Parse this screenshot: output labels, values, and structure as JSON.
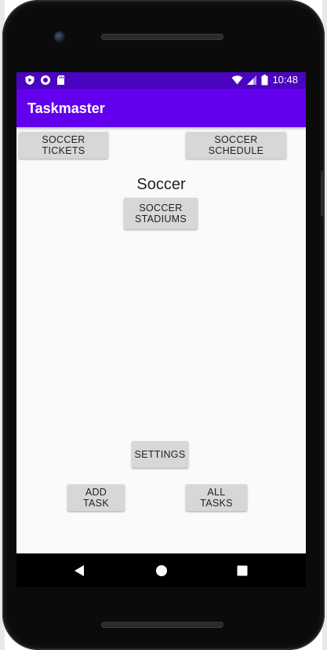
{
  "status_bar": {
    "time": "10:48",
    "icons_left": [
      "play-protect-icon",
      "circle-notification-icon",
      "sd-card-icon"
    ],
    "icons_right": [
      "wifi-icon",
      "signal-icon",
      "battery-icon"
    ]
  },
  "app_bar": {
    "title": "Taskmaster"
  },
  "main": {
    "buttons_top": {
      "tickets": "SOCCER TICKETS",
      "schedule": "SOCCER SCHEDULE"
    },
    "heading": "Soccer",
    "stadiums_button": "SOCCER\nSTADIUMS",
    "settings_button": "SETTINGS",
    "add_task_button": "ADD TASK",
    "all_tasks_button": "ALL TASKS"
  },
  "nav_bar": {
    "icons": [
      "back-icon",
      "home-icon",
      "recents-icon"
    ]
  },
  "colors": {
    "status_bar": "#4b04bf",
    "app_bar": "#6200ee",
    "screen_background": "#fafafa",
    "button": "#d6d7d7"
  }
}
